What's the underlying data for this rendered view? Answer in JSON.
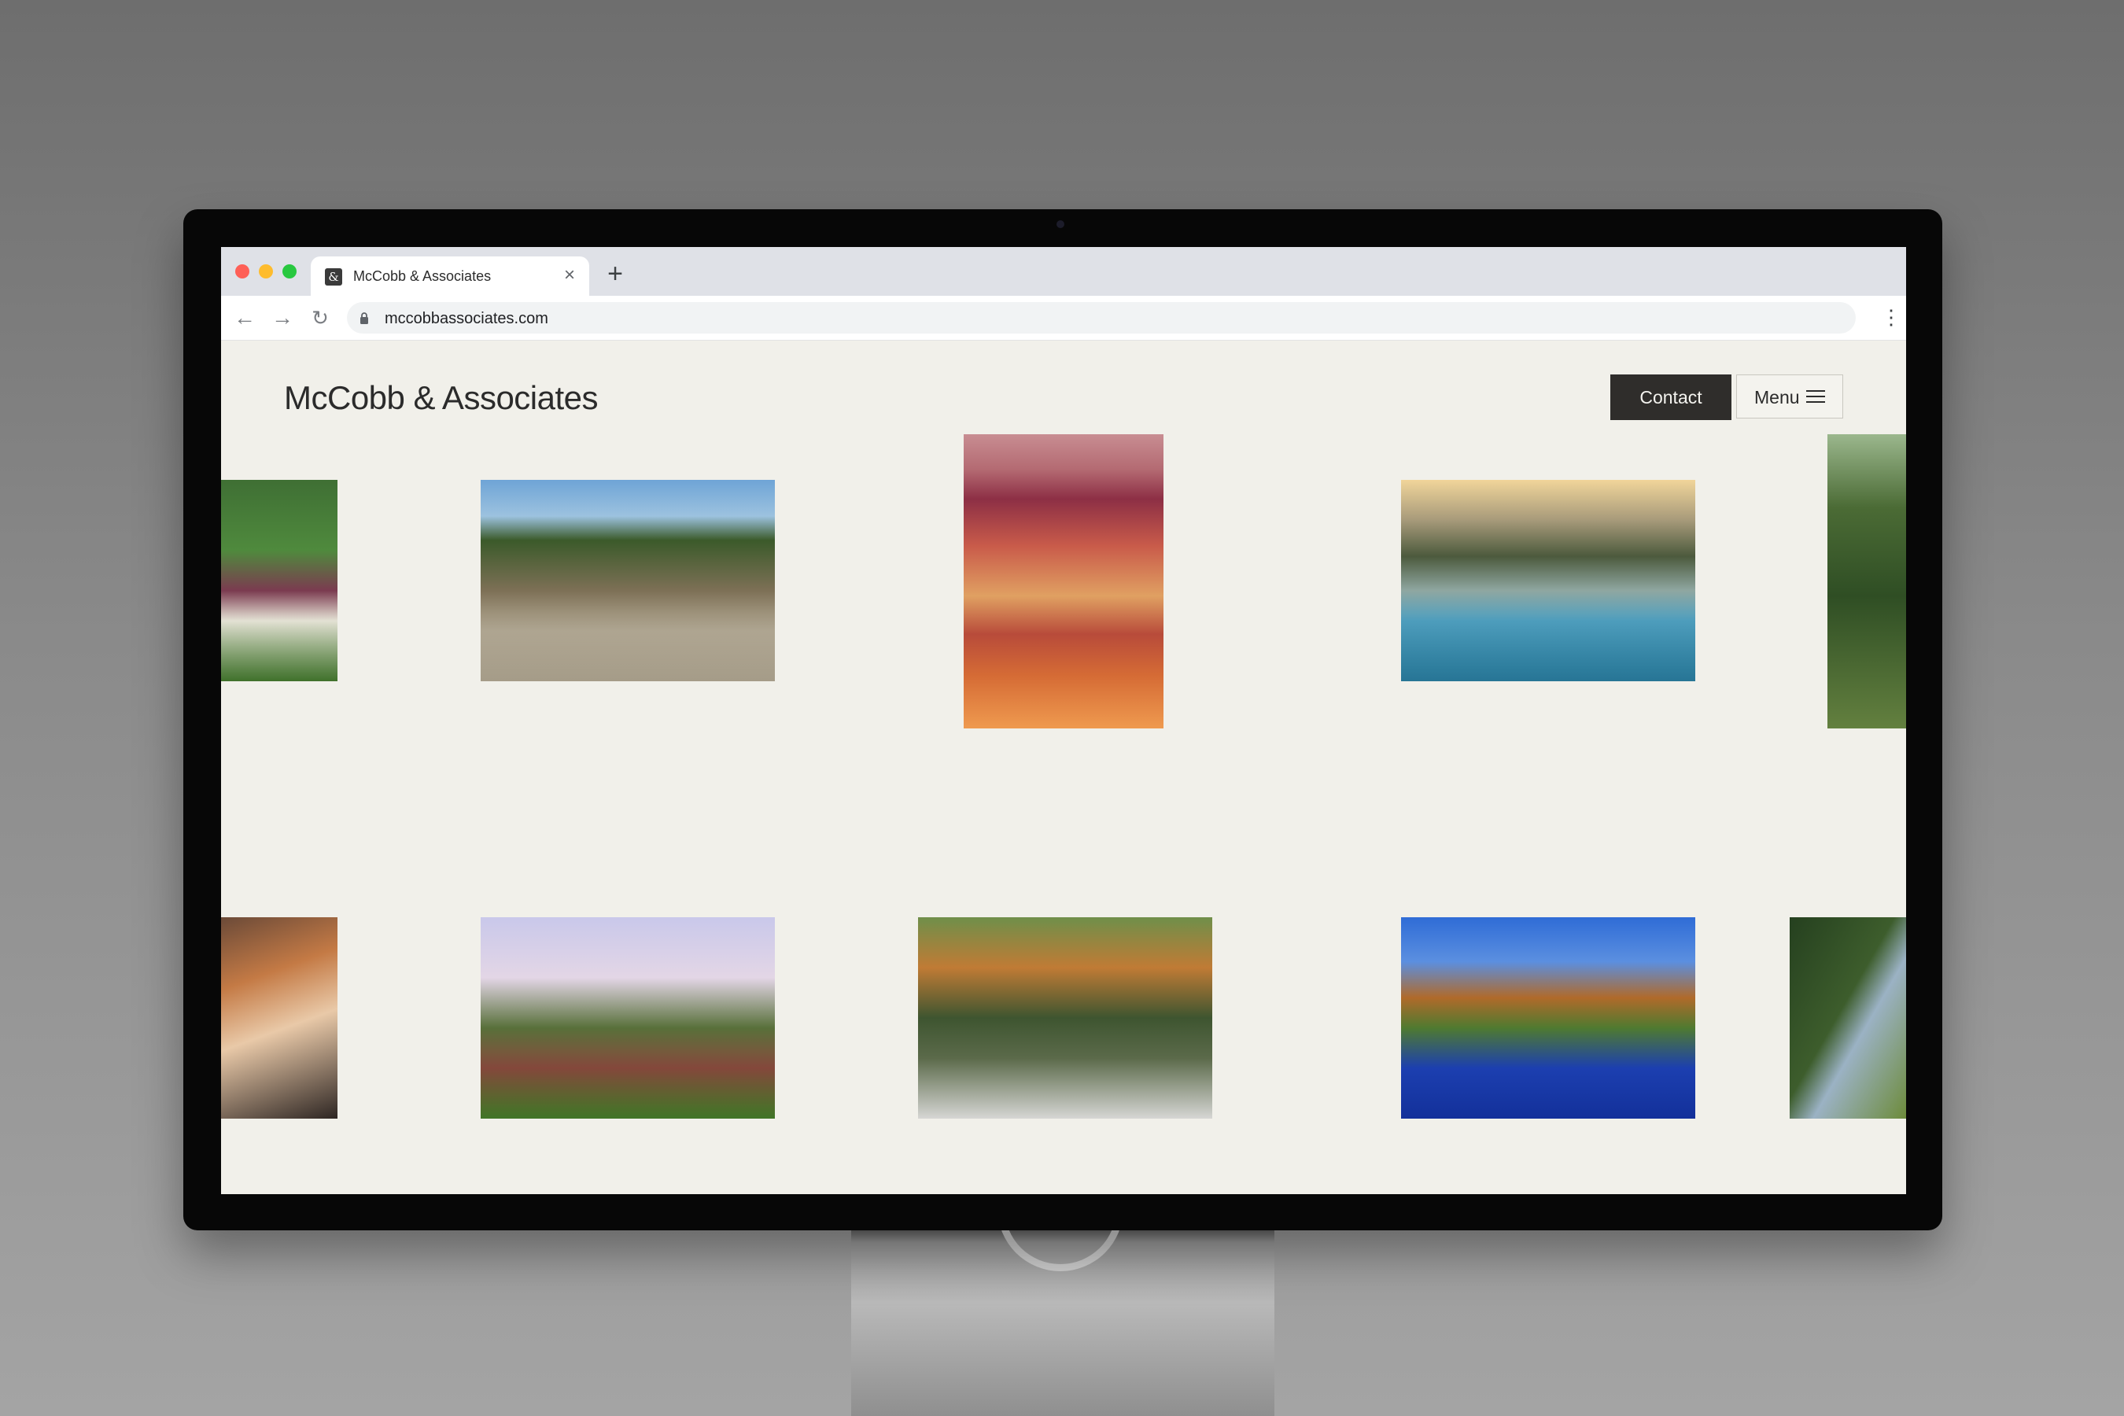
{
  "browser": {
    "tab": {
      "title": "McCobb & Associates",
      "favicon_glyph": "&",
      "close_glyph": "×"
    },
    "new_tab_glyph": "+",
    "nav": {
      "back_glyph": "←",
      "forward_glyph": "→",
      "reload_glyph": "↻"
    },
    "url": "mccobbassociates.com",
    "menu_glyph": "⋮"
  },
  "site": {
    "logo": "McCobb & Associates",
    "contact_label": "Contact",
    "menu_label": "Menu"
  },
  "gallery": [
    {
      "name": "garden-flowers-image"
    },
    {
      "name": "villa-courtyard-image"
    },
    {
      "name": "landscape-painting-image"
    },
    {
      "name": "infinity-pool-sunset-image"
    },
    {
      "name": "meadow-grass-image"
    },
    {
      "name": "interior-detail-image"
    },
    {
      "name": "shingle-house-garden-image"
    },
    {
      "name": "city-park-statue-image"
    },
    {
      "name": "park-lake-skyline-image"
    },
    {
      "name": "hillside-trees-image"
    }
  ]
}
